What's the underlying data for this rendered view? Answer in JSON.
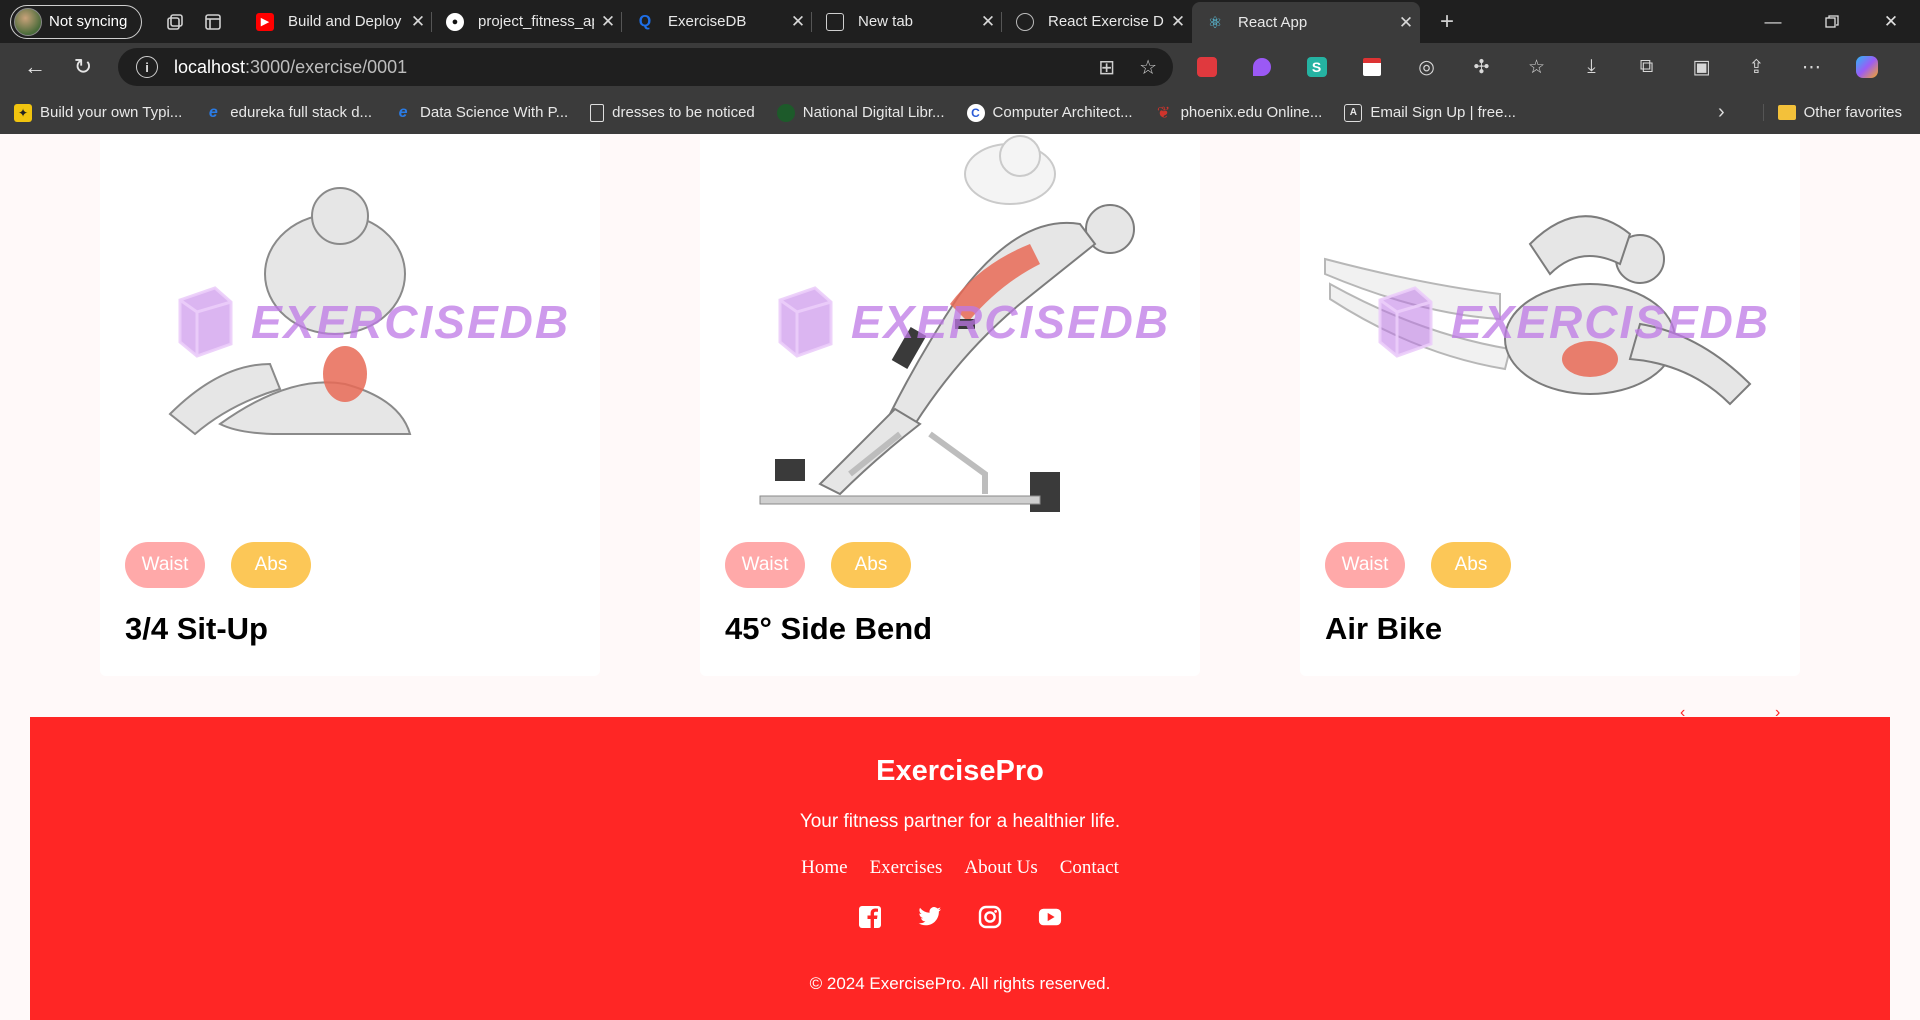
{
  "browser": {
    "profile_label": "Not syncing",
    "tabs": [
      {
        "title": "Build and Deploy a Moc",
        "favicon": "youtube-icon",
        "color": "#ff0000"
      },
      {
        "title": "project_fitness_app/src/",
        "favicon": "github-icon",
        "color": "#ffffff"
      },
      {
        "title": "ExerciseDB",
        "favicon": "exercisedb-icon",
        "color": "#1e6fe8"
      },
      {
        "title": "New tab",
        "favicon": "newtab-icon",
        "color": "#cfcfcf"
      },
      {
        "title": "React Exercise Detail De",
        "favicon": "openai-icon",
        "color": "#cfcfcf"
      },
      {
        "title": "React App",
        "favicon": "react-icon",
        "color": "#61dafb"
      }
    ],
    "address": {
      "host": "localhost",
      "path": ":3000/exercise/0001"
    },
    "bookmarks": [
      {
        "label": "Build your own Typi...",
        "favicon": "bookmark-typing-icon"
      },
      {
        "label": "edureka full stack d...",
        "favicon": "edureka-icon"
      },
      {
        "label": "Data Science With P...",
        "favicon": "edureka-icon"
      },
      {
        "label": "dresses to be noticed",
        "favicon": "page-icon"
      },
      {
        "label": "National Digital Libr...",
        "favicon": "ndl-icon"
      },
      {
        "label": "Computer Architect...",
        "favicon": "coursera-icon"
      },
      {
        "label": "phoenix.edu Online...",
        "favicon": "phoenix-icon"
      },
      {
        "label": "Email Sign Up | free...",
        "favicon": "alpha-icon"
      }
    ],
    "other_favorites": "Other favorites"
  },
  "exercises": [
    {
      "name": "3/4 Sit-Up",
      "body_part": "Waist",
      "target": "Abs"
    },
    {
      "name": "45° Side Bend",
      "body_part": "Waist",
      "target": "Abs"
    },
    {
      "name": "Air Bike",
      "body_part": "Waist",
      "target": "Abs"
    }
  ],
  "watermark_text": "EXERCISEDB",
  "footer": {
    "brand": "ExercisePro",
    "tagline": "Your fitness partner for a healthier life.",
    "links": [
      "Home",
      "Exercises",
      "About Us",
      "Contact"
    ],
    "socials": [
      "facebook-icon",
      "twitter-icon",
      "instagram-icon",
      "youtube-icon"
    ],
    "copyright": "© 2024 ExercisePro. All rights reserved."
  },
  "colors": {
    "accent": "#ff2625",
    "waist_pill": "#ffa9a9",
    "abs_pill": "#fcc757"
  }
}
